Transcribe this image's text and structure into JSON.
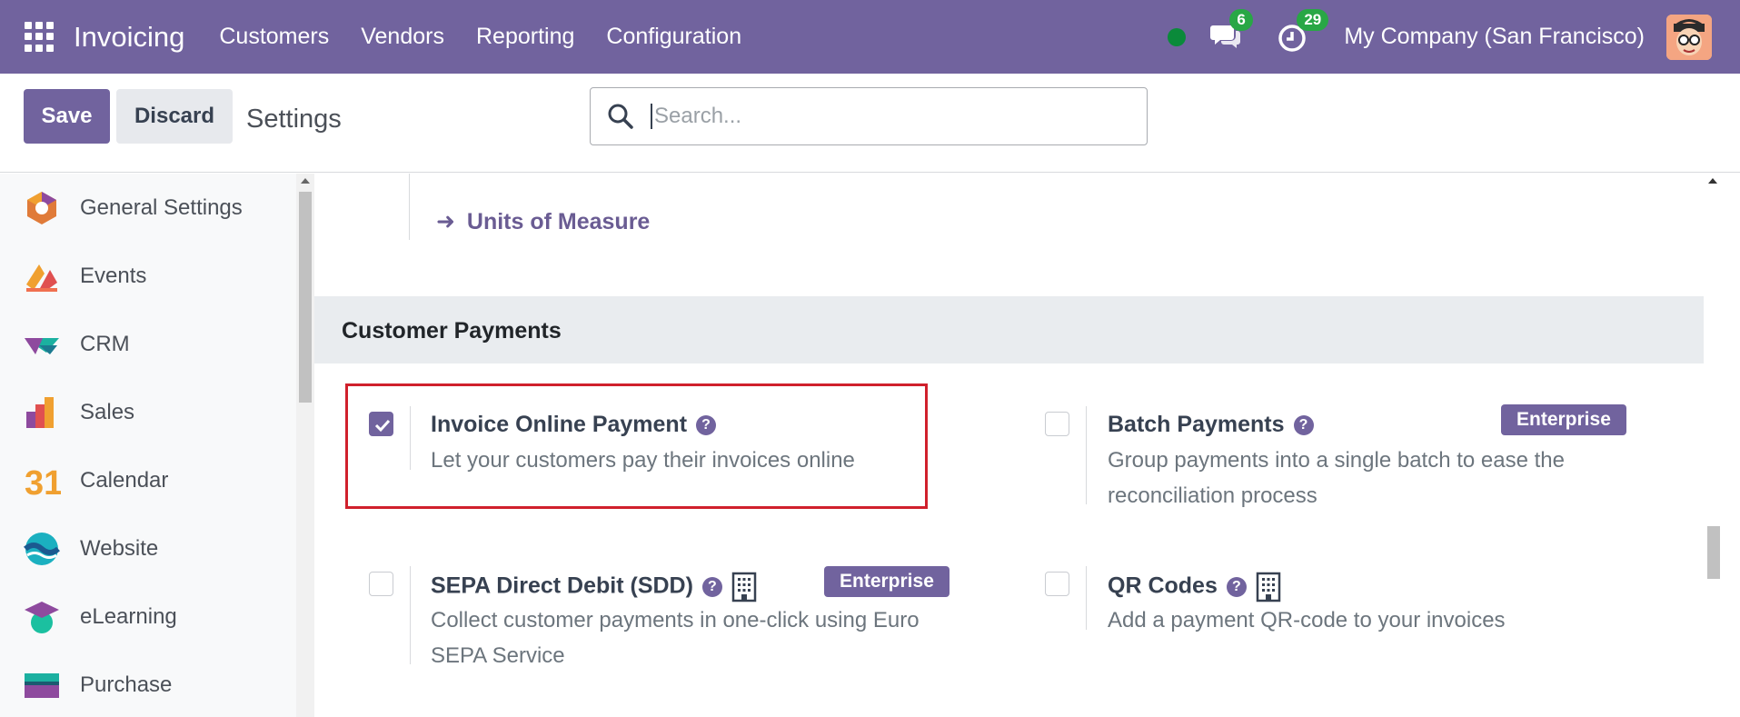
{
  "navbar": {
    "brand": "Invoicing",
    "menu": [
      "Customers",
      "Vendors",
      "Reporting",
      "Configuration"
    ],
    "messages_count": "6",
    "activities_count": "29",
    "company": "My Company (San Francisco)"
  },
  "control": {
    "save_label": "Save",
    "discard_label": "Discard",
    "title": "Settings",
    "search_placeholder": "Search..."
  },
  "sidebar": {
    "items": [
      {
        "label": "General Settings",
        "icon": "general-settings-icon"
      },
      {
        "label": "Events",
        "icon": "events-icon"
      },
      {
        "label": "CRM",
        "icon": "crm-icon"
      },
      {
        "label": "Sales",
        "icon": "sales-icon"
      },
      {
        "label": "Calendar",
        "icon": "calendar-icon",
        "glyph": "31"
      },
      {
        "label": "Website",
        "icon": "website-icon"
      },
      {
        "label": "eLearning",
        "icon": "elearning-icon"
      },
      {
        "label": "Purchase",
        "icon": "purchase-icon"
      }
    ]
  },
  "main": {
    "uom_link": "Units of Measure",
    "section_title": "Customer Payments",
    "settings": [
      {
        "title": "Invoice Online Payment",
        "desc": "Let your customers pay their invoices online",
        "checked": true,
        "enterprise": false
      },
      {
        "title": "Batch Payments",
        "desc": "Group payments into a single batch to ease the reconciliation process",
        "checked": false,
        "enterprise": true
      },
      {
        "title": "SEPA Direct Debit (SDD)",
        "desc": "Collect customer payments in one-click using Euro SEPA Service",
        "checked": false,
        "enterprise": true
      },
      {
        "title": "QR Codes",
        "desc": "Add a payment QR-code to your invoices",
        "checked": false,
        "enterprise": false
      }
    ],
    "enterprise_label": "Enterprise",
    "help_glyph": "?"
  },
  "colors": {
    "primary": "#71639e",
    "badge": "#28a745",
    "highlight": "#d0202c"
  }
}
